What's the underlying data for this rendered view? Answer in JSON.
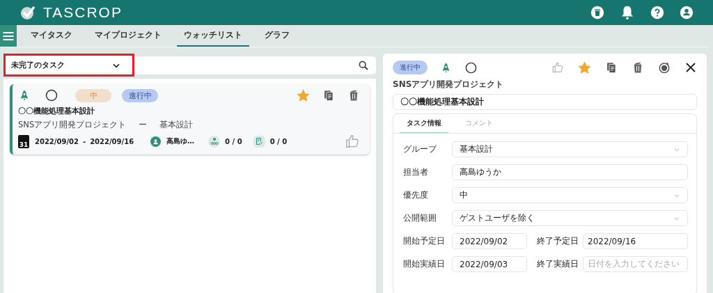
{
  "app": {
    "name": "TASCROP"
  },
  "nav_tabs": [
    {
      "label": "マイタスク",
      "selected": false
    },
    {
      "label": "マイプロジェクト",
      "selected": false
    },
    {
      "label": "ウォッチリスト",
      "selected": true
    },
    {
      "label": "グラフ",
      "selected": false
    }
  ],
  "filter": {
    "value": "未完了のタスク",
    "highlighted": true
  },
  "tasks": [
    {
      "priority": "中",
      "status": "進行中",
      "starred": true,
      "title": "〇〇機能処理基本設計",
      "project": "SNSアプリ開発プロジェクト",
      "separator": "ー",
      "group": "基本設計",
      "calendar_day": "31",
      "start": "2022/09/02",
      "date_separator": "-",
      "end": "2022/09/16",
      "assignee": "高島ゆ…",
      "subtasks": "0 / 0",
      "checklist": "0 / 0"
    }
  ],
  "detail": {
    "status": "進行中",
    "starred": true,
    "project": "SNSアプリ開発プロジェクト",
    "title": "〇〇機能処理基本設計",
    "tabs": [
      {
        "label": "タスク情報",
        "selected": true
      },
      {
        "label": "コメント",
        "selected": false
      }
    ],
    "fields": [
      {
        "label": "グループ",
        "value": "基本設計",
        "kind": "select"
      },
      {
        "label": "担当者",
        "value": "高島ゆうか",
        "kind": "text"
      },
      {
        "label": "優先度",
        "value": "中",
        "kind": "select"
      },
      {
        "label": "公開範囲",
        "value": "ゲストユーザを除く",
        "kind": "select"
      }
    ],
    "date_rows": [
      [
        {
          "label": "開始予定日",
          "value": "2022/09/02"
        },
        {
          "label": "終了予定日",
          "value": "2022/09/16"
        }
      ],
      [
        {
          "label": "開始実績日",
          "value": "2022/09/03"
        },
        {
          "label": "終了実績日",
          "placeholder": "日付を入力してください"
        }
      ]
    ]
  }
}
